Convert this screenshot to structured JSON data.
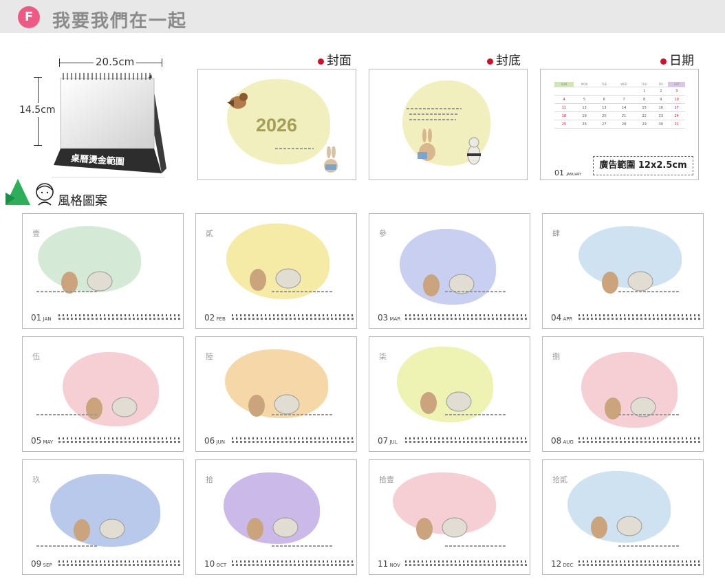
{
  "header": {
    "badge": "F",
    "title": "我要我們在一起"
  },
  "product": {
    "width_label": "20.5cm",
    "height_label": "14.5cm",
    "brand_label": "桌曆燙金範圍"
  },
  "sections": {
    "cover": "封面",
    "back": "封底",
    "dates": "日期",
    "style": "風格圖案"
  },
  "cover_card": {
    "year": "2026"
  },
  "dates_card": {
    "weekdays": [
      "SUN",
      "MON",
      "TUE",
      "WED",
      "THU",
      "FRI",
      "SAT"
    ],
    "ad_label": "廣告範圍 12x2.5cm",
    "footer_num": "01",
    "footer_month": "JANUARY"
  },
  "months": [
    {
      "num": "01",
      "abbr": "JAN",
      "kanji": "壹"
    },
    {
      "num": "02",
      "abbr": "FEB",
      "kanji": "貳"
    },
    {
      "num": "03",
      "abbr": "MAR",
      "kanji": "參"
    },
    {
      "num": "04",
      "abbr": "APR",
      "kanji": "肆"
    },
    {
      "num": "05",
      "abbr": "MAY",
      "kanji": "伍"
    },
    {
      "num": "06",
      "abbr": "JUN",
      "kanji": "陸"
    },
    {
      "num": "07",
      "abbr": "JUL",
      "kanji": "柒"
    },
    {
      "num": "08",
      "abbr": "AUG",
      "kanji": "捌"
    },
    {
      "num": "09",
      "abbr": "SEP",
      "kanji": "玖"
    },
    {
      "num": "10",
      "abbr": "OCT",
      "kanji": "拾"
    },
    {
      "num": "11",
      "abbr": "NOV",
      "kanji": "拾壹"
    },
    {
      "num": "12",
      "abbr": "DEC",
      "kanji": "拾貳"
    }
  ],
  "colors": {
    "accent_pink": "#ef5a85",
    "dot_red": "#d0102a",
    "header_gray": "#e8e8e8"
  }
}
